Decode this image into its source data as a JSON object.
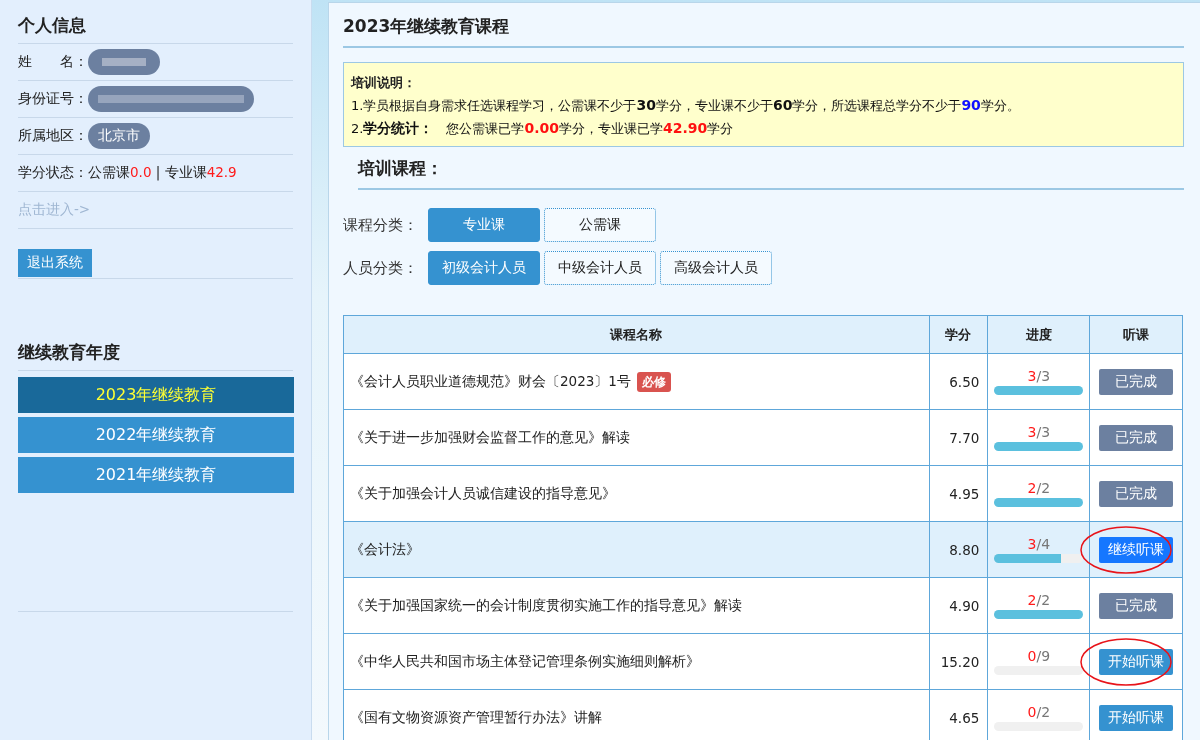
{
  "profile": {
    "title": "个人信息",
    "fields": [
      {
        "label": "姓　　名：",
        "kind": "redacted"
      },
      {
        "label": "身份证号：",
        "kind": "redacted-long"
      },
      {
        "label": "所属地区：",
        "kind": "pill",
        "value": "北京市"
      }
    ],
    "credit_status": {
      "label": "学分状态：",
      "parts": [
        {
          "text": "公需课",
          "kind": "plain"
        },
        {
          "text": "0.0",
          "kind": "value"
        },
        {
          "text": " | 专业课",
          "kind": "plain"
        },
        {
          "text": "42.9",
          "kind": "value"
        }
      ]
    },
    "enter_link": "点击进入->",
    "logout": "退出系统"
  },
  "years": {
    "title": "继续教育年度",
    "items": [
      {
        "label": "2023年继续教育",
        "selected": true
      },
      {
        "label": "2022年继续教育",
        "selected": false
      },
      {
        "label": "2021年继续教育",
        "selected": false
      }
    ]
  },
  "main": {
    "title": "2023年继续教育课程",
    "notice": {
      "title": "培训说明：",
      "lines": [
        [
          {
            "text": "1.学员根据自身需求任选课程学习，公需课不少于",
            "kind": "plain"
          },
          {
            "text": "30",
            "kind": "strong"
          },
          {
            "text": "学分，专业课不少于",
            "kind": "plain"
          },
          {
            "text": "60",
            "kind": "strong"
          },
          {
            "text": "学分，所选课程总学分不少于",
            "kind": "plain"
          },
          {
            "text": "90",
            "kind": "total"
          },
          {
            "text": "学分。",
            "kind": "plain"
          }
        ],
        [
          {
            "text": "2.",
            "kind": "plain"
          },
          {
            "text": "学分统计：",
            "kind": "strong"
          },
          {
            "text": "　您公需课已学",
            "kind": "plain"
          },
          {
            "text": "0.00",
            "kind": "earned"
          },
          {
            "text": "学分，专业课已学",
            "kind": "plain"
          },
          {
            "text": "42.90",
            "kind": "earned"
          },
          {
            "text": "学分",
            "kind": "plain"
          }
        ]
      ]
    },
    "section_title": "培训课程：",
    "filters": [
      {
        "label": "课程分类：",
        "options": [
          {
            "label": "专业课",
            "selected": true
          },
          {
            "label": "公需课",
            "selected": false
          }
        ]
      },
      {
        "label": "人员分类：",
        "options": [
          {
            "label": "初级会计人员",
            "selected": true
          },
          {
            "label": "中级会计人员",
            "selected": false
          },
          {
            "label": "高级会计人员",
            "selected": false
          }
        ]
      }
    ],
    "table": {
      "columns": [
        "课程名称",
        "学分",
        "进度",
        "听课"
      ],
      "rows": [
        {
          "name": "《会计人员职业道德规范》财会〔2023〕1号",
          "badge": "必修",
          "credit": "6.50",
          "done": "3",
          "total": "/3",
          "level": 1,
          "action": "已完成",
          "kind": "done",
          "selected": false,
          "circled": false
        },
        {
          "name": "《关于进一步加强财会监督工作的意见》解读",
          "credit": "7.70",
          "done": "3",
          "total": "/3",
          "level": 1,
          "action": "已完成",
          "kind": "done",
          "selected": false,
          "circled": false
        },
        {
          "name": "《关于加强会计人员诚信建设的指导意见》",
          "credit": "4.95",
          "done": "2",
          "total": "/2",
          "level": 1,
          "action": "已完成",
          "kind": "done",
          "selected": false,
          "circled": false
        },
        {
          "name": "《会计法》",
          "credit": "8.80",
          "done": "3",
          "total": "/4",
          "level": 0.75,
          "action": "继续听课",
          "kind": "continue",
          "selected": true,
          "circled": true
        },
        {
          "name": "《关于加强国家统一的会计制度贯彻实施工作的指导意见》解读",
          "credit": "4.90",
          "done": "2",
          "total": "/2",
          "level": 1,
          "action": "已完成",
          "kind": "done",
          "selected": false,
          "circled": false
        },
        {
          "name": "《中华人民共和国市场主体登记管理条例实施细则解析》",
          "credit": "15.20",
          "done": "0",
          "total": "/9",
          "level": 0,
          "action": "开始听课",
          "kind": "start",
          "selected": false,
          "circled": true
        },
        {
          "name": "《国有文物资源资产管理暂行办法》讲解",
          "credit": "4.65",
          "done": "0",
          "total": "/2",
          "level": 0,
          "action": "开始听课",
          "kind": "start",
          "selected": false,
          "circled": false
        }
      ]
    }
  }
}
